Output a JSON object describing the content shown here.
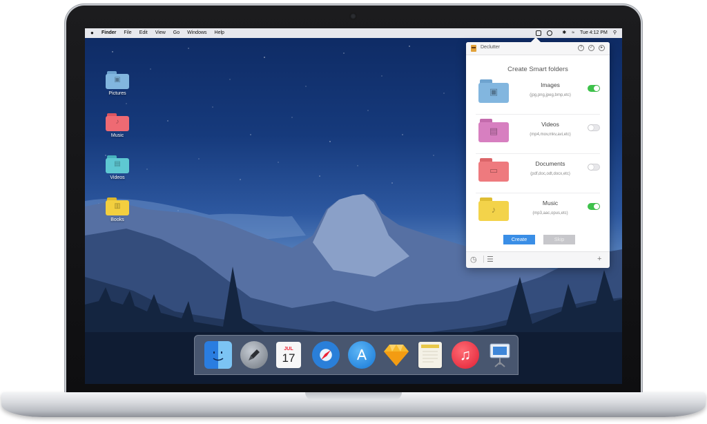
{
  "menubar": {
    "apple": "",
    "items": [
      "Finder",
      "File",
      "Edit",
      "View",
      "Go",
      "Windows",
      "Help"
    ],
    "clock": "Tue 4:12 PM",
    "wifi_icon": "wifi-icon",
    "spotlight_icon": "search-icon"
  },
  "desktop": {
    "icons": [
      {
        "label": "Pictures",
        "color": "#7fb4de",
        "glyph": "▣"
      },
      {
        "label": "Music",
        "color": "#ee6a73",
        "glyph": "♪"
      },
      {
        "label": "Videos",
        "color": "#5ec8d2",
        "glyph": "▤"
      },
      {
        "label": "Books",
        "color": "#f3cf3f",
        "glyph": "▥"
      }
    ]
  },
  "declutter": {
    "title": "Declutter",
    "heading": "Create Smart folders",
    "help_icon": "?",
    "rows": [
      {
        "name": "Images",
        "extensions": "(jpg,png,jpeg,bmp,etc)",
        "enabled": true,
        "color": "#82b6df",
        "glyph": "▣"
      },
      {
        "name": "Videos",
        "extensions": "(mp4,mov,mkv,avi,etc)",
        "enabled": false,
        "color": "#d77fc0",
        "glyph": "▤"
      },
      {
        "name": "Documents",
        "extensions": "(pdf,doc,odt,docx,etc)",
        "enabled": false,
        "color": "#ee7a7e",
        "glyph": "▭"
      },
      {
        "name": "Music",
        "extensions": "(mp3,aac,opus,etc)",
        "enabled": true,
        "color": "#f3d34a",
        "glyph": "♪"
      }
    ],
    "create_label": "Create",
    "skip_label": "Skip",
    "add_label": "+"
  },
  "dock": {
    "apps": [
      {
        "name": "finder",
        "color": "#3b8ee8"
      },
      {
        "name": "launchpad",
        "color": "#8f969f"
      },
      {
        "name": "calendar",
        "color": "#f4f4f4"
      },
      {
        "name": "safari",
        "color": "#2a7fd9"
      },
      {
        "name": "app-store",
        "color": "#1c8ce8"
      },
      {
        "name": "sketch",
        "color": "#f4b32c"
      },
      {
        "name": "notes",
        "color": "#f2f0ea"
      },
      {
        "name": "music",
        "color": "#e8323f"
      },
      {
        "name": "keynote",
        "color": "#dde3ec"
      }
    ],
    "calendar_month": "JUL",
    "calendar_day": "17"
  },
  "colors": {
    "accent": "#3a8ee6",
    "toggle_on": "#3ec24b"
  }
}
